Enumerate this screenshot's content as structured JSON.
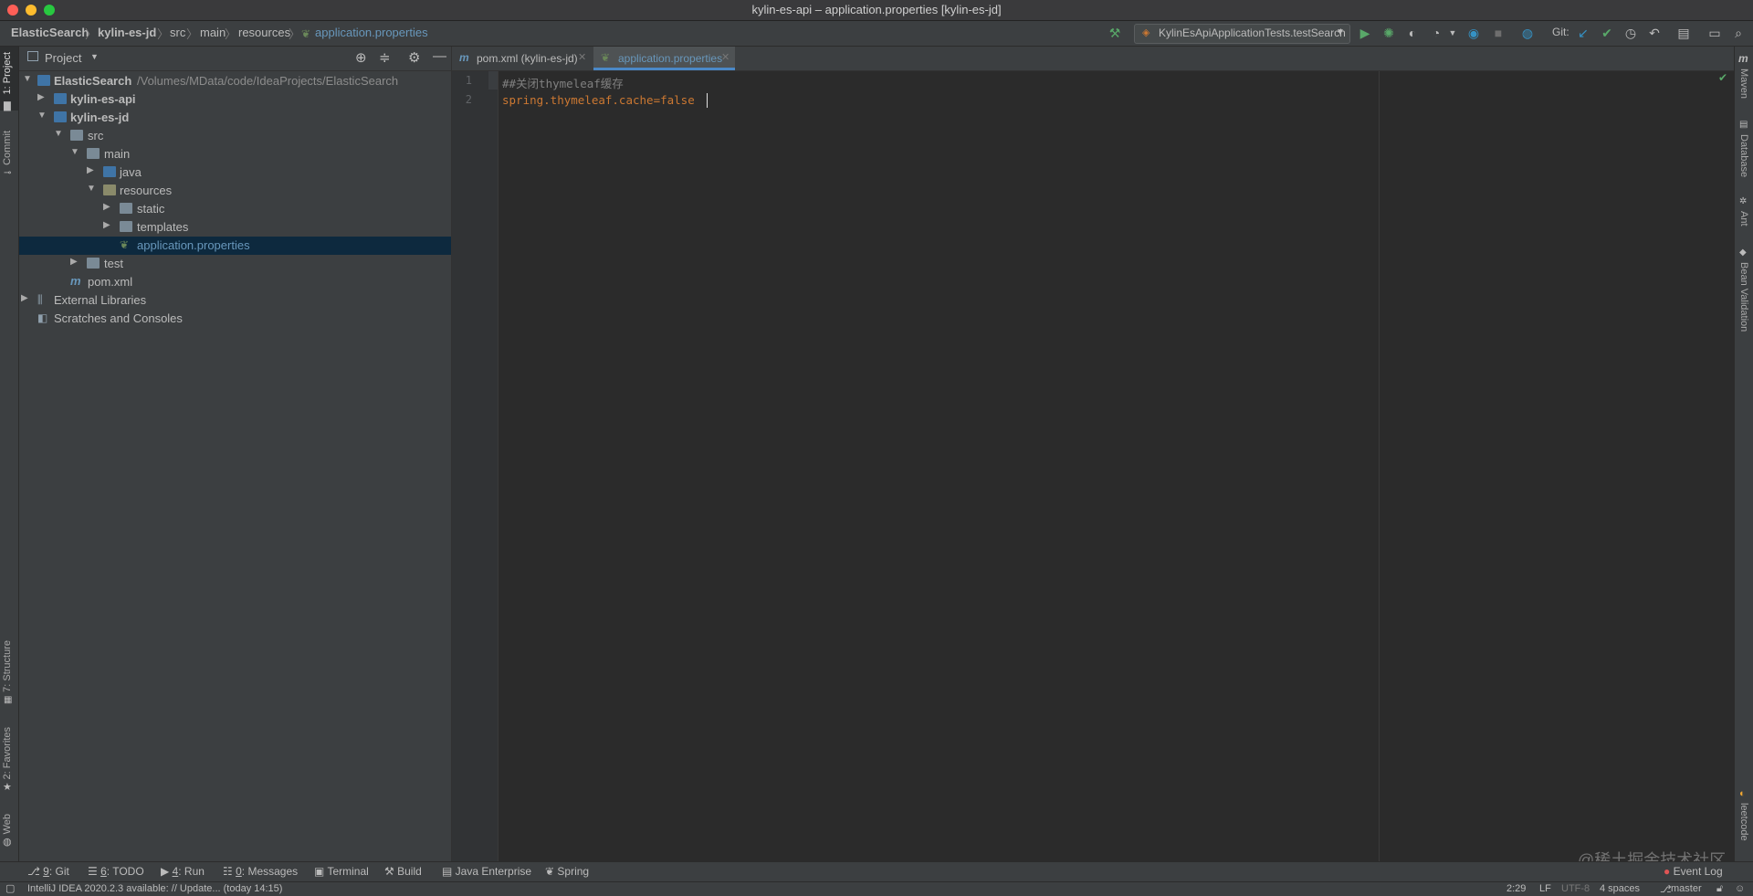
{
  "window": {
    "title": "kylin-es-api – application.properties [kylin-es-jd]"
  },
  "navbar": {
    "crumbs": [
      "ElasticSearch",
      "kylin-es-jd",
      "src",
      "main",
      "resources",
      "application.properties"
    ],
    "run_config": "KylinEsApiApplicationTests.testSearch",
    "git_label": "Git:"
  },
  "left_strip": {
    "project": "1: Project",
    "commit": "Commit",
    "structure": "7: Structure",
    "favorites": "2: Favorites",
    "web": "Web"
  },
  "right_strip": {
    "maven": "Maven",
    "database": "Database",
    "ant": "Ant",
    "bean_validation": "Bean Validation",
    "leetcode": "leetcode"
  },
  "project_panel": {
    "title": "Project",
    "tree": [
      {
        "label": "ElasticSearch",
        "path": "/Volumes/MData/code/IdeaProjects/ElasticSearch"
      },
      {
        "label": "kylin-es-api"
      },
      {
        "label": "kylin-es-jd"
      },
      {
        "label": "src"
      },
      {
        "label": "main"
      },
      {
        "label": "java"
      },
      {
        "label": "resources"
      },
      {
        "label": "static"
      },
      {
        "label": "templates"
      },
      {
        "label": "application.properties"
      },
      {
        "label": "test"
      },
      {
        "label": "pom.xml"
      },
      {
        "label": "External Libraries"
      },
      {
        "label": "Scratches and Consoles"
      }
    ]
  },
  "editor": {
    "tabs": [
      {
        "label": "pom.xml (kylin-es-jd)"
      },
      {
        "label": "application.properties"
      }
    ],
    "lines": [
      {
        "num": "1",
        "text": "##关闭thymeleaf缓存"
      },
      {
        "num": "2",
        "text": "spring.thymeleaf.cache=false"
      }
    ]
  },
  "tool_windows": [
    {
      "num": "9",
      "label": ": Git"
    },
    {
      "num": "6",
      "label": ": TODO"
    },
    {
      "num": "4",
      "label": ": Run"
    },
    {
      "num": "0",
      "label": ": Messages"
    },
    {
      "num": "",
      "label": "Terminal"
    },
    {
      "num": "",
      "label": "Build"
    },
    {
      "num": "",
      "label": "Java Enterprise"
    },
    {
      "num": "",
      "label": "Spring"
    }
  ],
  "event_log": "Event Log",
  "status": {
    "message": "IntelliJ IDEA 2020.2.3 available: // Update... (today 14:15)",
    "position": "2:29",
    "line_sep": "LF",
    "encoding": "UTF-8",
    "indent": "4 spaces",
    "branch": "master"
  },
  "watermark": "@稀土掘金技术社区",
  "colors": {
    "accent": "#4a88c7",
    "comment": "#808080",
    "property_key": "#cc7832",
    "selection": "#0d293e"
  }
}
